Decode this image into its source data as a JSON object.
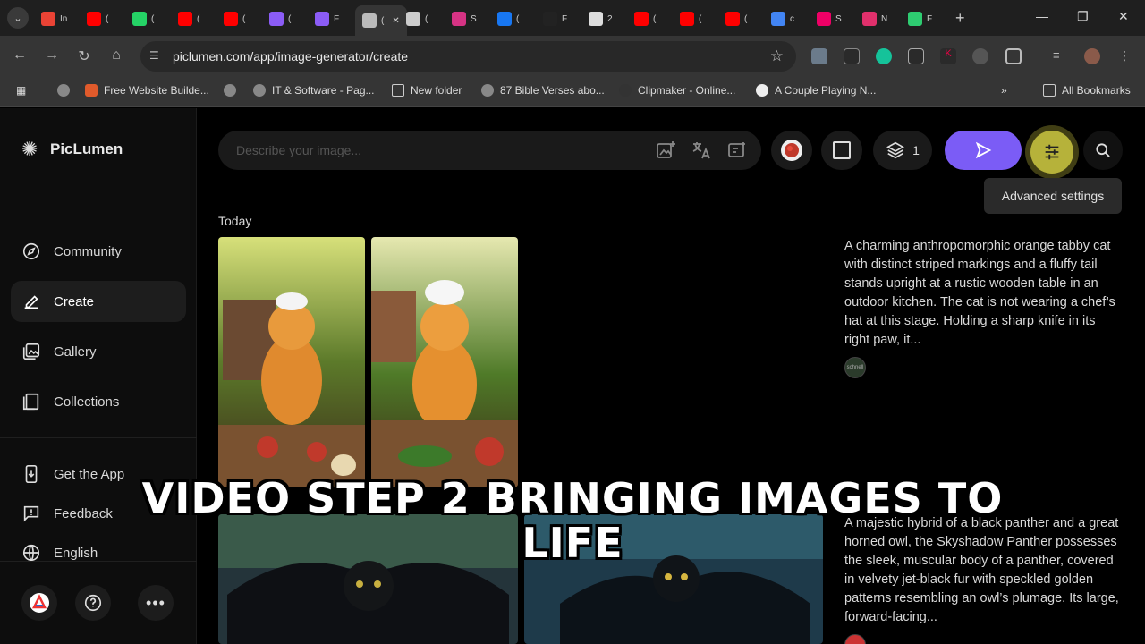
{
  "browser": {
    "url": "piclumen.com/app/image-generator/create",
    "tabs": [
      {
        "label": "In",
        "color": "#ea4335"
      },
      {
        "label": "(",
        "color": "#ff0000"
      },
      {
        "label": "(",
        "color": "#25d366"
      },
      {
        "label": "(",
        "color": "#ff0000"
      },
      {
        "label": "(",
        "color": "#ff0000"
      },
      {
        "label": "(",
        "color": "#8b5cf6"
      },
      {
        "label": "F",
        "color": "#8b5cf6"
      },
      {
        "label": "(",
        "color": "#bbbbbb"
      },
      {
        "label": "(",
        "color": "#cccccc"
      },
      {
        "label": "S",
        "color": "#d63384"
      },
      {
        "label": "(",
        "color": "#1877f2"
      },
      {
        "label": "F",
        "color": "#222222"
      },
      {
        "label": "2",
        "color": "#dddddd"
      },
      {
        "label": "(",
        "color": "#ff0000"
      },
      {
        "label": "(",
        "color": "#ff0000"
      },
      {
        "label": "(",
        "color": "#ff0000"
      },
      {
        "label": "c",
        "color": "#4285f4"
      },
      {
        "label": "S",
        "color": "#e06"
      },
      {
        "label": "N",
        "color": "#e1306c"
      },
      {
        "label": "F",
        "color": "#2ecc71"
      }
    ],
    "bookmarks": [
      {
        "label": "Free Website Builde..."
      },
      {
        "label": "IT & Software - Pag..."
      },
      {
        "label": "New folder"
      },
      {
        "label": "87 Bible Verses abo..."
      },
      {
        "label": "Clipmaker - Online..."
      },
      {
        "label": "A Couple Playing N..."
      }
    ],
    "all_bookmarks": "All Bookmarks"
  },
  "app": {
    "brand": "PicLumen",
    "nav": [
      {
        "label": "Community"
      },
      {
        "label": "Create"
      },
      {
        "label": "Gallery"
      },
      {
        "label": "Collections"
      }
    ],
    "nav_bottom": [
      {
        "label": "Get the App"
      },
      {
        "label": "Feedback"
      },
      {
        "label": "English"
      }
    ],
    "prompt_placeholder": "Describe your image...",
    "batch_count": "1",
    "tooltip": "Advanced settings",
    "section_title": "Today",
    "model_badge": "schnell",
    "descriptions": [
      "A charming anthropomorphic orange tabby cat with distinct striped markings and a fluffy tail stands upright at a rustic wooden table in an outdoor kitchen. The cat is not wearing a chef’s hat at this stage. Holding a sharp knife in its right paw, it...",
      "A majestic hybrid of a black panther and a great horned owl, the Skyshadow Panther possesses the sleek, muscular body of a panther, covered in velvety jet-black fur with speckled golden patterns resembling an owl’s plumage. Its large, forward-facing..."
    ],
    "accent_color": "#7b5cf6"
  },
  "caption": {
    "line1": "VIDEO STEP 2 BRINGING IMAGES TO",
    "line2": "LIFE"
  }
}
